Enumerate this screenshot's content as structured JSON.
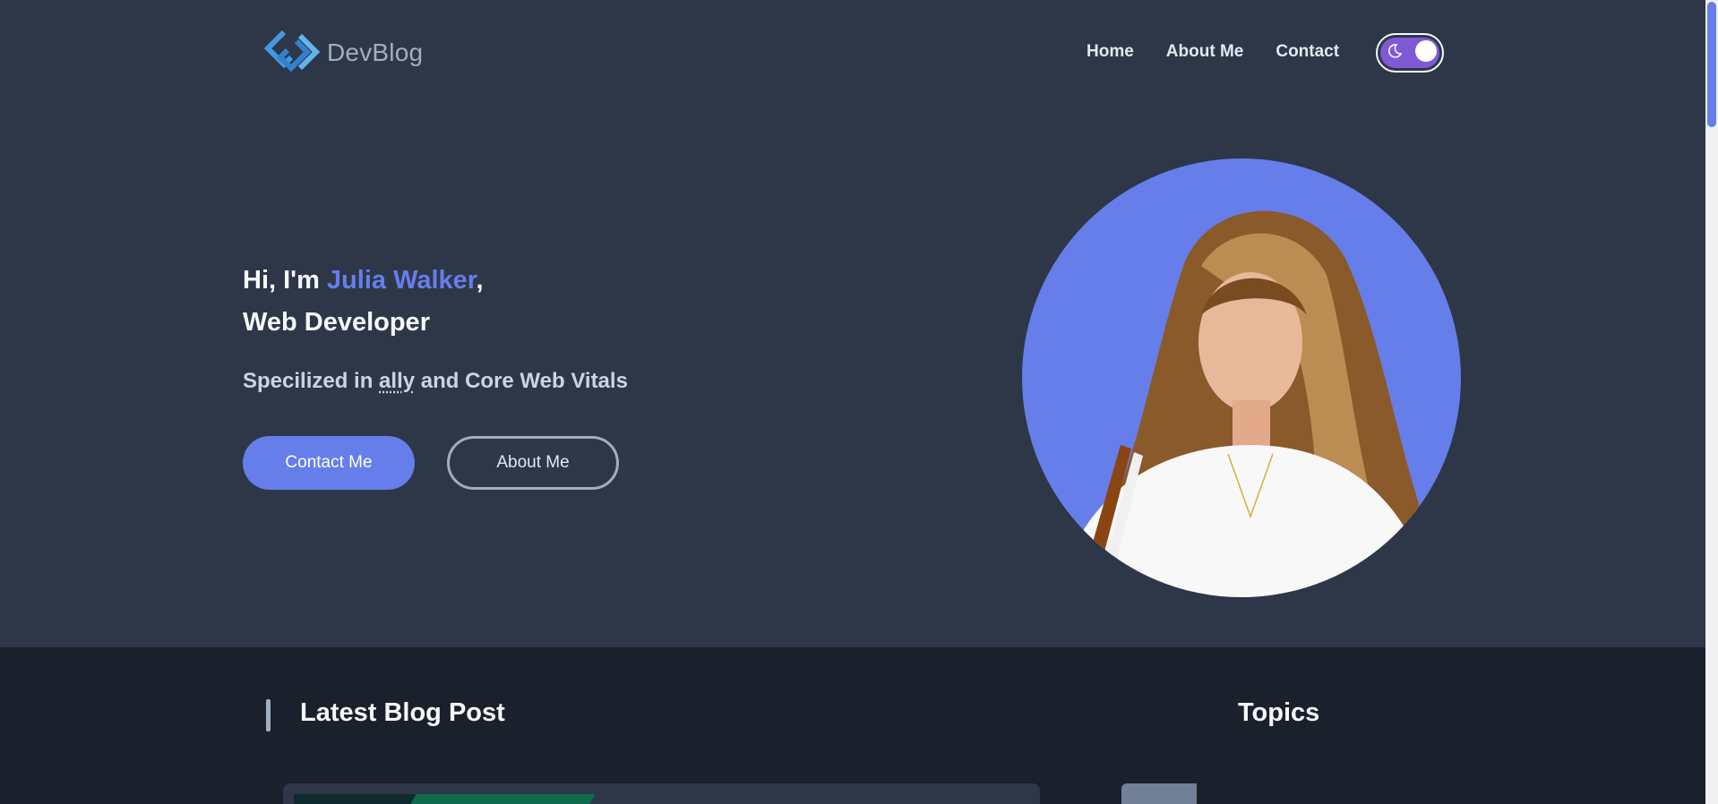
{
  "header": {
    "logo_text": "DevBlog",
    "nav": [
      "Home",
      "About Me",
      "Contact"
    ],
    "theme_toggle": {
      "state": "dark",
      "icon": "moon-icon"
    }
  },
  "hero": {
    "greeting_prefix": "Hi, I'm ",
    "name": "Julia Walker",
    "greeting_suffix": ",",
    "role": "Web Developer",
    "subtitle_prefix": "Specilized in ",
    "subtitle_abbr": "ally",
    "subtitle_suffix": " and Core Web Vitals",
    "primary_button": "Contact Me",
    "secondary_button": "About Me"
  },
  "sections": {
    "latest_title": "Latest Blog Post",
    "topics_title": "Topics"
  },
  "colors": {
    "accent": "#667eea",
    "background": "#2d3748",
    "background_dark": "#1a202c",
    "toggle": "#805ad5"
  }
}
